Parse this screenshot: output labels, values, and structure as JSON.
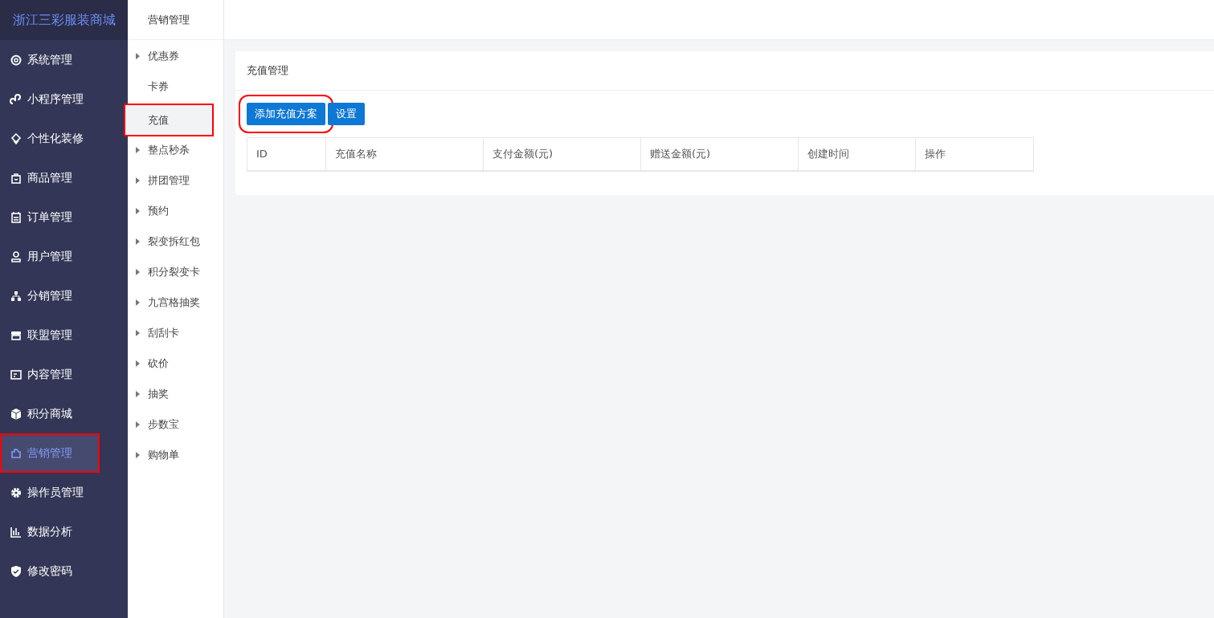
{
  "brand": "浙江三彩服装商城",
  "nav": [
    {
      "label": "系统管理",
      "selected": false,
      "highlighted": false
    },
    {
      "label": "小程序管理",
      "selected": false,
      "highlighted": false
    },
    {
      "label": "个性化装修",
      "selected": false,
      "highlighted": false
    },
    {
      "label": "商品管理",
      "selected": false,
      "highlighted": false
    },
    {
      "label": "订单管理",
      "selected": false,
      "highlighted": false
    },
    {
      "label": "用户管理",
      "selected": false,
      "highlighted": false
    },
    {
      "label": "分销管理",
      "selected": false,
      "highlighted": false
    },
    {
      "label": "联盟管理",
      "selected": false,
      "highlighted": false
    },
    {
      "label": "内容管理",
      "selected": false,
      "highlighted": false
    },
    {
      "label": "积分商城",
      "selected": false,
      "highlighted": false
    },
    {
      "label": "营销管理",
      "selected": true,
      "highlighted": true
    },
    {
      "label": "操作员管理",
      "selected": false,
      "highlighted": false
    },
    {
      "label": "数据分析",
      "selected": false,
      "highlighted": false
    },
    {
      "label": "修改密码",
      "selected": false,
      "highlighted": false
    }
  ],
  "submenu": {
    "title": "营销管理",
    "items": [
      {
        "label": "优惠券",
        "expandable": true,
        "selected": false,
        "highlighted": false
      },
      {
        "label": "卡券",
        "expandable": false,
        "selected": false,
        "highlighted": false
      },
      {
        "label": "充值",
        "expandable": false,
        "selected": true,
        "highlighted": true
      },
      {
        "label": "整点秒杀",
        "expandable": true,
        "selected": false,
        "highlighted": false
      },
      {
        "label": "拼团管理",
        "expandable": true,
        "selected": false,
        "highlighted": false
      },
      {
        "label": "预约",
        "expandable": true,
        "selected": false,
        "highlighted": false
      },
      {
        "label": "裂变拆红包",
        "expandable": true,
        "selected": false,
        "highlighted": false
      },
      {
        "label": "积分裂变卡",
        "expandable": true,
        "selected": false,
        "highlighted": false
      },
      {
        "label": "九宫格抽奖",
        "expandable": true,
        "selected": false,
        "highlighted": false
      },
      {
        "label": "刮刮卡",
        "expandable": true,
        "selected": false,
        "highlighted": false
      },
      {
        "label": "砍价",
        "expandable": true,
        "selected": false,
        "highlighted": false
      },
      {
        "label": "抽奖",
        "expandable": true,
        "selected": false,
        "highlighted": false
      },
      {
        "label": "步数宝",
        "expandable": true,
        "selected": false,
        "highlighted": false
      },
      {
        "label": "购物单",
        "expandable": true,
        "selected": false,
        "highlighted": false
      }
    ]
  },
  "panel": {
    "title": "充值管理",
    "buttons": [
      {
        "label": "添加充值方案",
        "highlighted": true
      },
      {
        "label": "设置",
        "highlighted": false
      }
    ],
    "table": {
      "columns": [
        "ID",
        "充值名称",
        "支付金额(元)",
        "赠送金额(元)",
        "创建时间",
        "操作"
      ]
    }
  }
}
